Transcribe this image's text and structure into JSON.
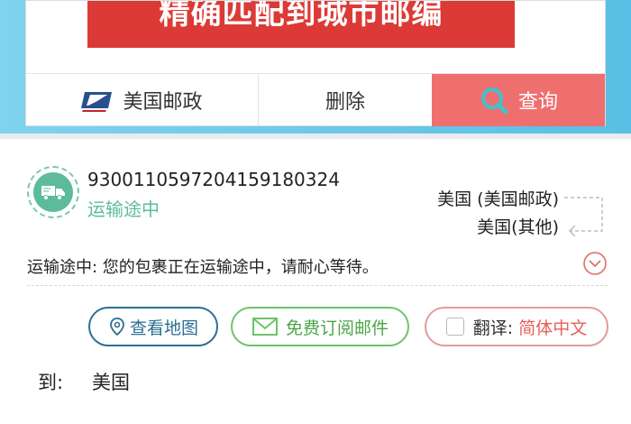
{
  "banner": {
    "text": "精确匹配到城市邮编"
  },
  "actions": {
    "carrier_label": "美国邮政",
    "delete_label": "删除",
    "query_label": "查询"
  },
  "shipment": {
    "tracking_number": "9300110597204159180324",
    "status": "运输途中",
    "origin": "美国 (美国邮政)",
    "destination": "美国(其他)",
    "status_message": "运输途中: 您的包裹正在运输途中，请耐心等待。"
  },
  "buttons": {
    "map": "查看地图",
    "subscribe": "免费订阅邮件",
    "translate": "翻译:",
    "language": "简体中文"
  },
  "to": {
    "label": "到:",
    "value": "美国"
  },
  "colors": {
    "accent_red": "#ef6f6f",
    "banner_red": "#dc3a36",
    "status_green": "#5dbb9d",
    "map_blue": "#2b6f93"
  },
  "icons": [
    "usps-logo",
    "search-icon",
    "truck-icon",
    "map-pin-icon",
    "mail-icon",
    "chevron-down-icon",
    "route-arrow-icon"
  ]
}
